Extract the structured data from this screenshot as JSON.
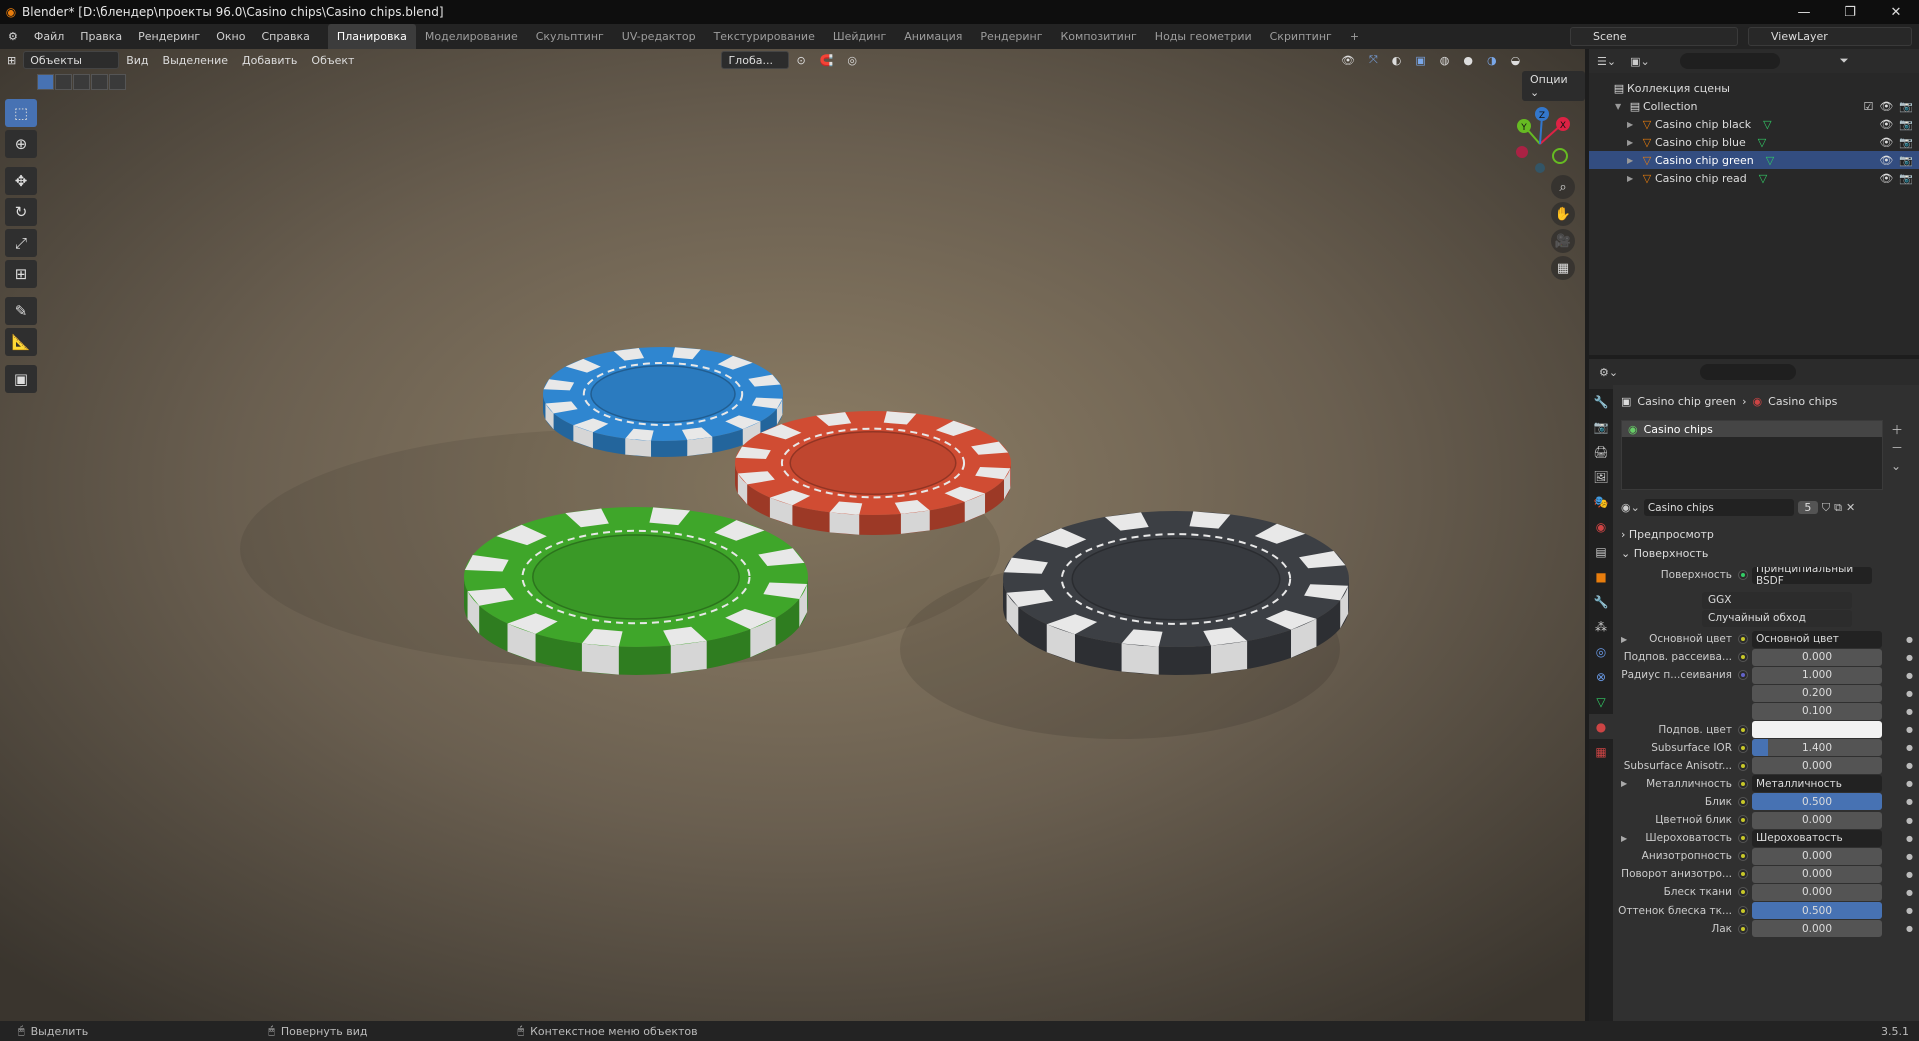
{
  "window": {
    "title": "Blender* [D:\\блендер\\проекты 96.0\\Casino chips\\Casino chips.blend]",
    "minimize": "—",
    "maximize": "❐",
    "close": "✕"
  },
  "menu": [
    "Файл",
    "Правка",
    "Рендеринг",
    "Окно",
    "Справка"
  ],
  "workspaces": [
    "Планировка",
    "Моделирование",
    "Скульптинг",
    "UV-редактор",
    "Текстурирование",
    "Шейдинг",
    "Анимация",
    "Рендеринг",
    "Композитинг",
    "Ноды геометрии",
    "Скриптинг"
  ],
  "active_workspace": "Планировка",
  "add_workspace": "+",
  "scene": "Scene",
  "viewlayer": "ViewLayer",
  "viewport": {
    "mode": "Объекты",
    "menus": [
      "Вид",
      "Выделение",
      "Добавить",
      "Объект"
    ],
    "transform_orientation": "Глоба...",
    "options": "Опции",
    "gizmo_labels": {
      "x": "X",
      "y": "Y",
      "z": "Z"
    }
  },
  "outliner": {
    "root": "Коллекция сцены",
    "collection": "Collection",
    "objects": [
      {
        "name": "Casino chip black",
        "selected": false
      },
      {
        "name": "Casino chip blue",
        "selected": false
      },
      {
        "name": "Casino chip green",
        "selected": true
      },
      {
        "name": "Casino chip read",
        "selected": false
      }
    ]
  },
  "properties": {
    "breadcrumb": {
      "object": "Casino chip green",
      "material": "Casino chips"
    },
    "slot": "Casino chips",
    "material_name": "Casino chips",
    "users": "5",
    "panels": {
      "preview": "Предпросмотр",
      "surface": "Поверхность"
    },
    "surface": {
      "label": "Поверхность",
      "shader": "Принципиальный BSDF",
      "distribution": "GGX",
      "subsurface_method": "Случайный обход"
    },
    "rows": [
      {
        "label": "Основной цвет",
        "value": "Основной цвет",
        "kind": "link",
        "expand": true
      },
      {
        "label": "Подпов. рассеива...",
        "value": "0.000",
        "kind": "num",
        "fill": 0
      },
      {
        "label": "Радиус п...сеивания",
        "value": "1.000",
        "kind": "vec",
        "dot": "b"
      },
      {
        "label": "",
        "value": "0.200",
        "kind": "vec"
      },
      {
        "label": "",
        "value": "0.100",
        "kind": "vec"
      },
      {
        "label": "Подпов. цвет",
        "value": "",
        "kind": "color"
      },
      {
        "label": "Subsurface IOR",
        "value": "1.400",
        "kind": "num",
        "fill": 0.12
      },
      {
        "label": "Subsurface Anisotr...",
        "value": "0.000",
        "kind": "num",
        "fill": 0
      },
      {
        "label": "Металличность",
        "value": "Металличность",
        "kind": "link",
        "expand": true
      },
      {
        "label": "Блик",
        "value": "0.500",
        "kind": "num",
        "fill": 1.0
      },
      {
        "label": "Цветной блик",
        "value": "0.000",
        "kind": "num",
        "fill": 0
      },
      {
        "label": "Шероховатость",
        "value": "Шероховатость",
        "kind": "link",
        "expand": true
      },
      {
        "label": "Анизотропность",
        "value": "0.000",
        "kind": "num",
        "fill": 0
      },
      {
        "label": "Поворот анизотро...",
        "value": "0.000",
        "kind": "num",
        "fill": 0
      },
      {
        "label": "Блеск ткани",
        "value": "0.000",
        "kind": "num",
        "fill": 0
      },
      {
        "label": "Оттенок блеска тк...",
        "value": "0.500",
        "kind": "num",
        "fill": 1.0
      },
      {
        "label": "Лак",
        "value": "0.000",
        "kind": "num",
        "fill": 0
      }
    ]
  },
  "status": {
    "left": "Выделить",
    "middle": "Повернуть вид",
    "right": "Контекстное меню объектов",
    "version": "3.5.1"
  },
  "colors": {
    "accent": "#4772b3",
    "chip_blue": "#2f86d0",
    "chip_red": "#d04c33",
    "chip_green": "#3fa62a",
    "chip_black": "#3c3f44",
    "stripe": "#e8e8e8"
  }
}
